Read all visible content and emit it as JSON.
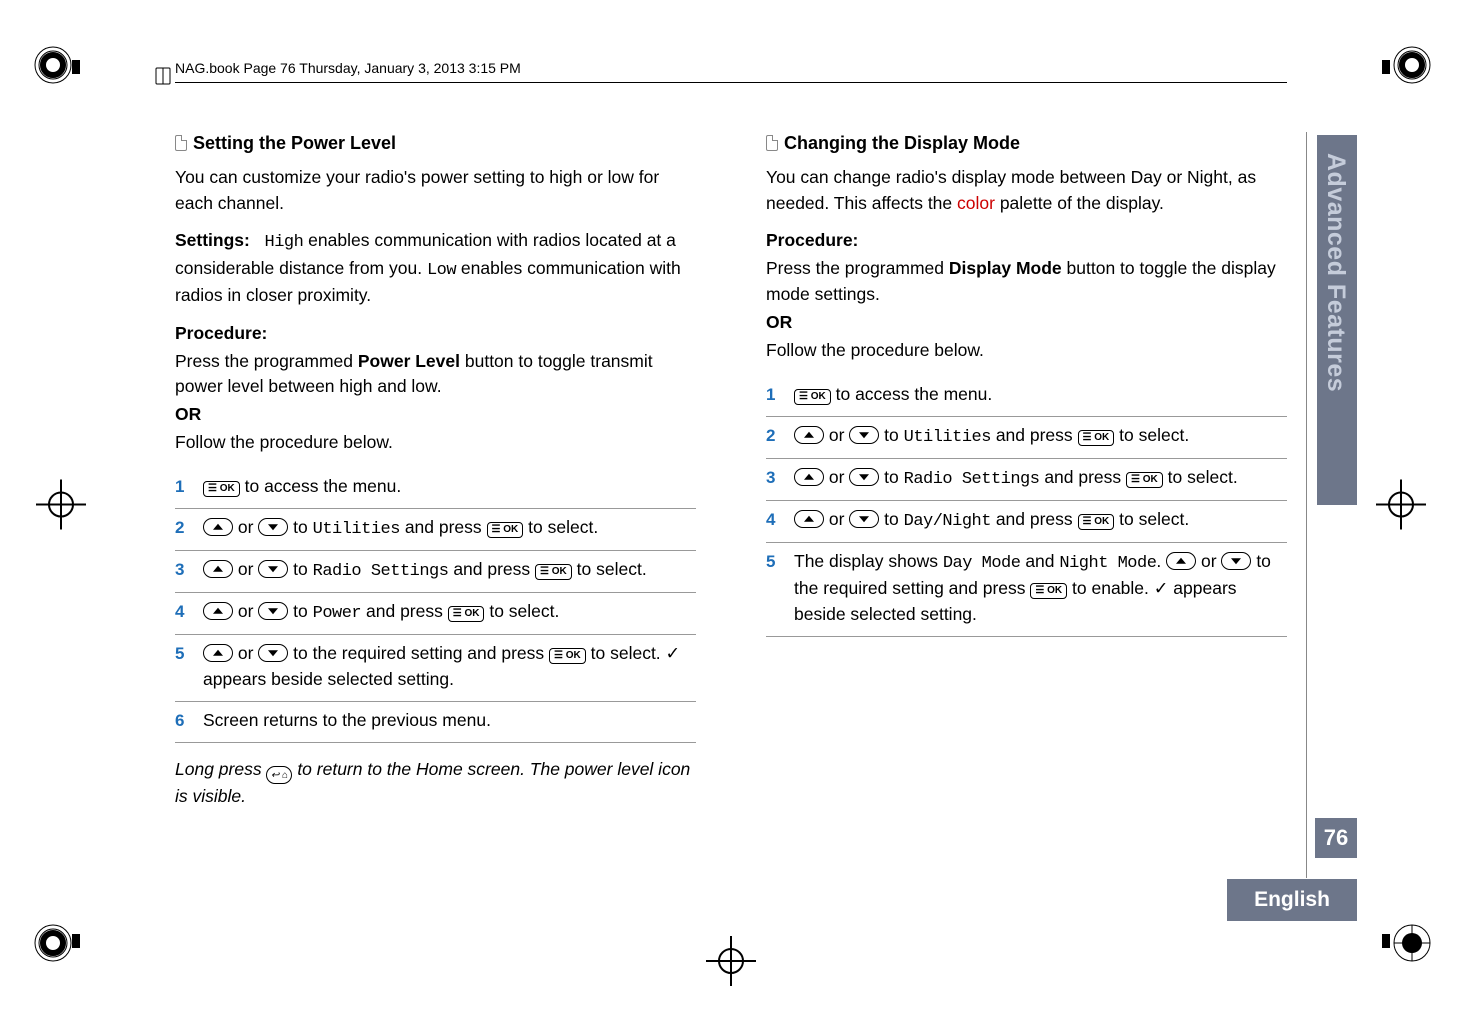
{
  "header": "NAG.book  Page 76  Thursday, January 3, 2013  3:15 PM",
  "side_tab": "Advanced Features",
  "page_number": "76",
  "language": "English",
  "left": {
    "title": "Setting the Power Level",
    "intro": "You can customize your radio's power setting to high or low for each channel.",
    "settings_label": "Settings:",
    "settings_high": "High",
    "settings_text_mid": " enables communication with radios located at a considerable distance from you. ",
    "settings_low": "Low",
    "settings_text_end": " enables communication with radios in closer proximity.",
    "procedure_label": "Procedure:",
    "procedure_text1": "Press the programmed ",
    "procedure_bold": "Power Level",
    "procedure_text2": " button to toggle transmit power level between high and low.",
    "or": "OR",
    "follow": "Follow the procedure below.",
    "steps": [
      {
        "n": "1",
        "pre": "",
        "body1": " to access the menu.",
        "type": "ok_only"
      },
      {
        "n": "2",
        "mid1": " to ",
        "mono": "Utilities",
        "mid2": " and press ",
        "end": " to select.",
        "type": "arrows_ok"
      },
      {
        "n": "3",
        "mid1": " to ",
        "mono": "Radio Settings",
        "mid2": " and press ",
        "end": " to select.",
        "type": "arrows_ok"
      },
      {
        "n": "4",
        "mid1": " to ",
        "mono": "Power",
        "mid2": " and press ",
        "end": " to select.",
        "type": "arrows_ok"
      },
      {
        "n": "5",
        "mid1": " to the required setting and press ",
        "end": " to select. ",
        "check_tail": " appears beside selected setting.",
        "type": "arrows_ok_check"
      },
      {
        "n": "6",
        "plain": "Screen returns to the previous menu.",
        "type": "plain"
      }
    ],
    "note_pre": "Long press ",
    "note_post": " to return to the Home screen. The power level icon is visible."
  },
  "right": {
    "title": "Changing the Display Mode",
    "intro_pre": "You can change radio's display mode between Day or Night, as needed. This affects the ",
    "intro_red": "color",
    "intro_post": " palette of the display.",
    "procedure_label": "Procedure:",
    "procedure_text1": "Press the programmed ",
    "procedure_bold": "Display Mode",
    "procedure_text2": " button to toggle the display mode settings.",
    "or": "OR",
    "follow": "Follow the procedure below.",
    "steps": [
      {
        "n": "1",
        "body1": " to access the menu.",
        "type": "ok_only"
      },
      {
        "n": "2",
        "mid1": " to ",
        "mono": "Utilities",
        "mid2": " and press ",
        "end": " to select.",
        "type": "arrows_ok"
      },
      {
        "n": "3",
        "mid1": " to ",
        "mono": "Radio Settings",
        "mid2": " and press ",
        "end": " to select.",
        "type": "arrows_ok"
      },
      {
        "n": "4",
        "mid1": " to ",
        "mono": "Day/Night",
        "mid2": " and press ",
        "end": " to select.",
        "type": "arrows_ok"
      },
      {
        "n": "5",
        "p1": "The display shows ",
        "mono1": "Day Mode",
        "p2": " and ",
        "mono2": "Night Mode",
        "p3": ". ",
        "p4": " to the required setting and press ",
        "p5": " to enable. ",
        "p6": " appears beside selected setting.",
        "type": "final"
      }
    ]
  }
}
